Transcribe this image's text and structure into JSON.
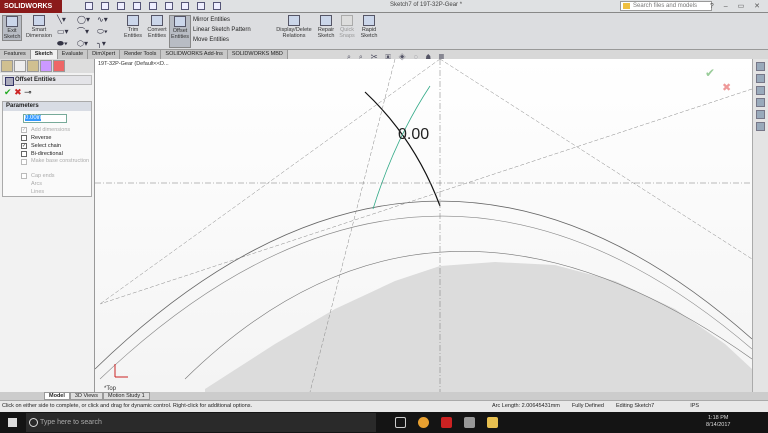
{
  "app": {
    "logo": "SOLIDWORKS",
    "title": "Sketch7 of 19T-32P-Gear *",
    "search_placeholder": "Search files and models",
    "win_controls": "? – ▭ ✕"
  },
  "ribbon": {
    "exit_sketch": "Exit Sketch",
    "smart_dimension": "Smart Dimension",
    "trim": "Trim Entities",
    "convert": "Convert Entities",
    "offset": "Offset Entities",
    "mirror": "Mirror Entities",
    "linear_pattern": "Linear Sketch Pattern",
    "move": "Move Entities",
    "display_delete": "Display/Delete Relations",
    "repair": "Repair Sketch",
    "quick_snaps": "Quick Snaps",
    "rapid": "Rapid Sketch"
  },
  "tabs": [
    "Features",
    "Sketch",
    "Evaluate",
    "DimXpert",
    "Render Tools",
    "SOLIDWORKS Add-Ins",
    "SOLIDWORKS MBD"
  ],
  "panel": {
    "title": "Offset Entities",
    "ok": "✔",
    "cancel": "✖",
    "group": "Parameters",
    "offset_value": "0.00in",
    "add_dimensions": "Add dimensions",
    "reverse": "Reverse",
    "select_chain": "Select chain",
    "bidirectional": "Bi-directional",
    "make_base": "Make base construction",
    "cap_ends": "Cap ends",
    "arcs": "Arcs",
    "lines": "Lines"
  },
  "graphics": {
    "tree_item": "19T-32P-Gear (Default<<D...",
    "dimension": "0.00",
    "view_label": "*Top",
    "hud": "⌕ ⌕ ✂ ▣ ◈ ◌ ☗ ▦"
  },
  "bottom_tabs": [
    "Model",
    "3D Views",
    "Motion Study 1"
  ],
  "status": {
    "hint": "Click on either side to complete, or click and drag for dynamic control.  Right-click for additional options.",
    "arc_length": "Arc Length: 2.00645431mm",
    "defined": "Fully Defined",
    "editing": "Editing Sketch7",
    "units": "IPS"
  },
  "taskbar": {
    "search": "Type here to search",
    "time": "1:18 PM",
    "date": "8/14/2017"
  }
}
